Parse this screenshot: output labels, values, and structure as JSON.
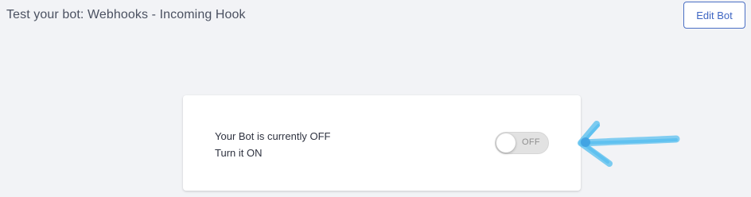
{
  "header": {
    "title": "Test your bot: Webhooks - Incoming Hook",
    "edit_button_label": "Edit Bot"
  },
  "bot_status": {
    "status_line": "Your Bot is currently OFF",
    "action_line": "Turn it ON",
    "toggle_label": "OFF",
    "toggle_on": false
  },
  "annotation": {
    "icon": "arrow-icon",
    "color": "#5cc0ef"
  },
  "colors": {
    "accent": "#3e66c3",
    "background": "#f2f3f6",
    "card": "#ffffff"
  }
}
